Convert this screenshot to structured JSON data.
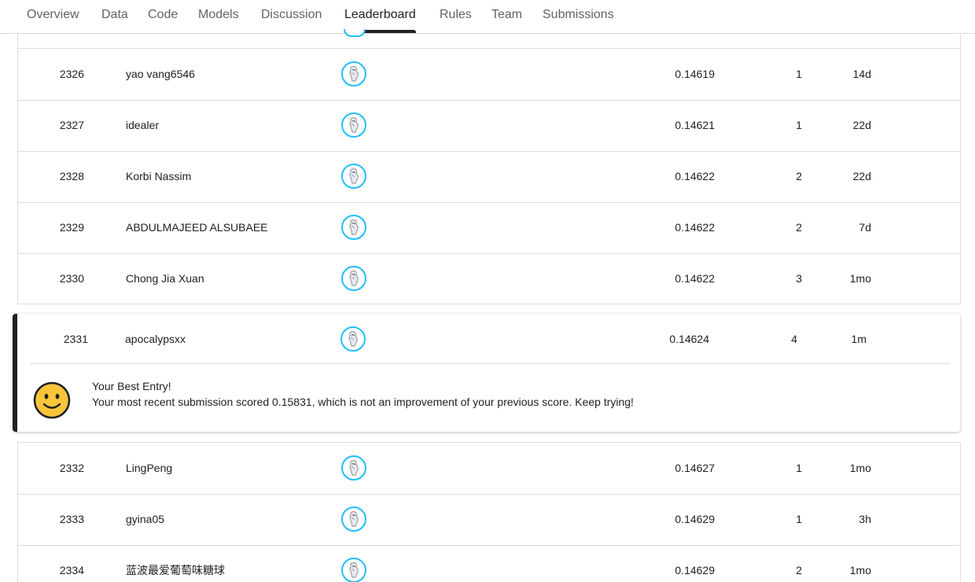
{
  "nav": {
    "tabs": [
      {
        "label": "Overview",
        "active": false
      },
      {
        "label": "Data",
        "active": false
      },
      {
        "label": "Code",
        "active": false
      },
      {
        "label": "Models",
        "active": false
      },
      {
        "label": "Discussion",
        "active": false
      },
      {
        "label": "Leaderboard",
        "active": true
      },
      {
        "label": "Rules",
        "active": false
      },
      {
        "label": "Team",
        "active": false
      },
      {
        "label": "Submissions",
        "active": false
      }
    ]
  },
  "leaderboard": {
    "rows_above": [
      {
        "rank": "2326",
        "team": "yao vang6546",
        "avatar": "default-avatar-icon",
        "score": "0.14619",
        "entries": "1",
        "last": "14d"
      },
      {
        "rank": "2327",
        "team": "idealer",
        "avatar": "default-avatar-icon",
        "score": "0.14621",
        "entries": "1",
        "last": "22d"
      },
      {
        "rank": "2328",
        "team": "Korbi Nassim",
        "avatar": "default-avatar-icon",
        "score": "0.14622",
        "entries": "2",
        "last": "22d"
      },
      {
        "rank": "2329",
        "team": "ABDULMAJEED ALSUBAEE",
        "avatar": "default-avatar-icon",
        "score": "0.14622",
        "entries": "2",
        "last": "7d"
      },
      {
        "rank": "2330",
        "team": "Chong Jia Xuan",
        "avatar": "default-avatar-icon",
        "score": "0.14622",
        "entries": "3",
        "last": "1mo"
      }
    ],
    "user_row": {
      "rank": "2331",
      "team": "apocalypsxx",
      "avatar": "default-avatar-icon",
      "score": "0.14624",
      "entries": "4",
      "last": "1m"
    },
    "user_message": {
      "title": "Your Best Entry!",
      "body": "Your most recent submission scored 0.15831, which is not an improvement of your previous score. Keep trying!",
      "icon": "smiley-icon"
    },
    "rows_below": [
      {
        "rank": "2332",
        "team": "LingPeng",
        "avatar": "default-avatar-icon",
        "score": "0.14627",
        "entries": "1",
        "last": "1mo"
      },
      {
        "rank": "2333",
        "team": "gyina05",
        "avatar": "default-avatar-icon",
        "score": "0.14629",
        "entries": "1",
        "last": "3h"
      },
      {
        "rank": "2334",
        "team": "蓝波最爱葡萄味糖球",
        "avatar": "default-avatar-icon",
        "score": "0.14629",
        "entries": "2",
        "last": "1mo"
      }
    ]
  },
  "colors": {
    "avatar_ring": "#20beff",
    "active_tab": "#202124",
    "inactive_tab": "#5f6368",
    "divider": "#dadce0",
    "smiley_fill": "#f8c53a"
  }
}
